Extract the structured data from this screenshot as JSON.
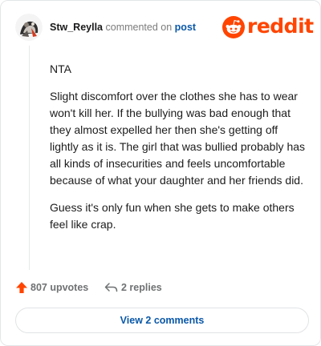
{
  "comment": {
    "username": "Stw_Reylla",
    "action": "commented on",
    "link_text": "post",
    "paragraphs": [
      "NTA",
      "Slight discomfort over the clothes she has to wear won't kill her. If the bullying was bad enough that they almost expelled her then she's getting off lightly as it is. The girl that was bullied probably has all kinds of insecurities and feels uncomfortable because of what your daughter and her friends did.",
      "Guess it's only fun when she gets to make others feel like crap."
    ]
  },
  "brand": {
    "wordmark": "reddit",
    "color": "#ff4500"
  },
  "footer": {
    "upvotes_label": "807 upvotes",
    "replies_label": "2 replies"
  },
  "view_button": {
    "label": "View 2 comments"
  },
  "icons": {
    "avatar": "avatar",
    "logo": "reddit-snoo-icon",
    "upvote": "upvote-arrow-icon",
    "reply": "reply-arrow-icon"
  },
  "colors": {
    "accent": "#ff4500",
    "link": "#0a58a8",
    "muted": "#6f7173",
    "border": "#e3e6e8"
  }
}
